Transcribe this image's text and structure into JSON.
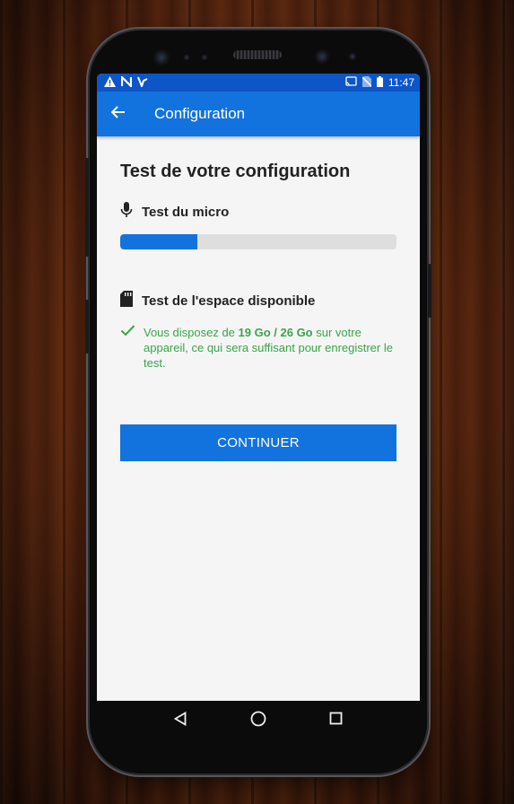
{
  "status_bar": {
    "time": "11:47",
    "left_icons": [
      "warning-icon",
      "nfc-icon",
      "app-notification-icon"
    ],
    "right_icons": [
      "cast-icon",
      "no-sim-icon",
      "battery-icon"
    ]
  },
  "app_bar": {
    "back_icon": "arrow-back-icon",
    "title": "Configuration"
  },
  "main": {
    "heading": "Test de votre configuration",
    "mic_test": {
      "icon": "microphone-icon",
      "label": "Test du micro",
      "progress_fraction": 0.28
    },
    "storage_test": {
      "icon": "sd-card-icon",
      "label": "Test de l'espace disponible",
      "check_icon": "check-icon",
      "message_prefix": "Vous disposez de ",
      "message_bold": "19 Go / 26 Go",
      "message_suffix": " sur votre appareil, ce qui sera suffisant pour enregistrer le test."
    },
    "continue_button": "CONTINUER"
  },
  "nav_bar": {
    "back": "nav-back-icon",
    "home": "nav-home-icon",
    "recents": "nav-recents-icon"
  },
  "colors": {
    "primary": "#1273de",
    "status_bar": "#0d56c8",
    "success": "#3aa54a",
    "progress_track": "#dedede"
  }
}
